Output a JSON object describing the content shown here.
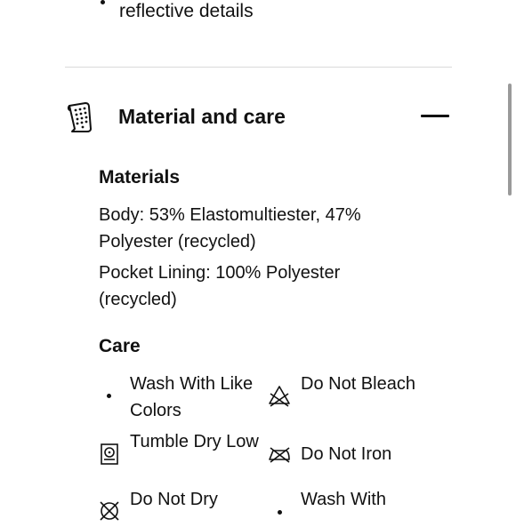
{
  "previous_section": {
    "item_text": "reflective details"
  },
  "accordion": {
    "title": "Material and care",
    "icon": "fabric-swatch-icon",
    "toggle_icon": "minus-icon"
  },
  "materials": {
    "heading": "Materials",
    "lines": [
      "Body: 53% Elastomultiester, 47% Polyester (recycled)",
      "Pocket Lining: 100% Polyester (recycled)"
    ]
  },
  "care": {
    "heading": "Care",
    "items": [
      {
        "label": "Wash With Like Colors",
        "icon": "bullet-dot"
      },
      {
        "label": "Do Not Bleach",
        "icon": "do-not-bleach-icon"
      },
      {
        "label": "Tumble Dry Low",
        "icon": "tumble-dry-low-icon"
      },
      {
        "label": "Do Not Iron",
        "icon": "do-not-iron-icon"
      },
      {
        "label": "Do Not Dry",
        "icon": "do-not-dry-clean-icon"
      },
      {
        "label": "Wash With",
        "icon": "bullet-dot"
      }
    ]
  }
}
